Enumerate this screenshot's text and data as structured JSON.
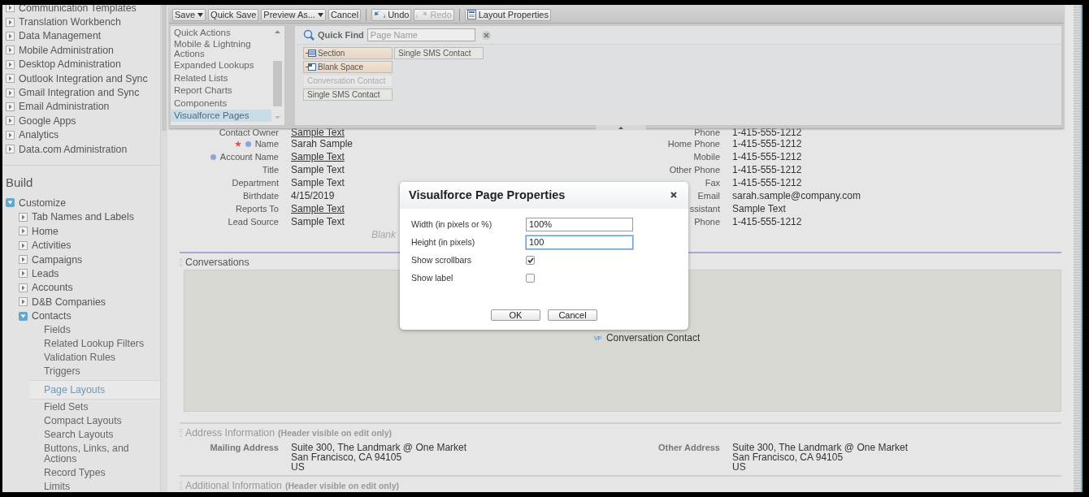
{
  "sidebar": {
    "items": [
      {
        "label": "Communication Templates",
        "kind": "node",
        "expanded": false
      },
      {
        "label": "Translation Workbench",
        "kind": "node",
        "expanded": false
      },
      {
        "label": "Data Management",
        "kind": "node",
        "expanded": false
      },
      {
        "label": "Mobile Administration",
        "kind": "node",
        "expanded": false
      },
      {
        "label": "Desktop Administration",
        "kind": "node",
        "expanded": false
      },
      {
        "label": "Outlook Integration and Sync",
        "kind": "node",
        "expanded": false
      },
      {
        "label": "Gmail Integration and Sync",
        "kind": "node",
        "expanded": false
      },
      {
        "label": "Email Administration",
        "kind": "node",
        "expanded": false
      },
      {
        "label": "Google Apps",
        "kind": "node",
        "expanded": false
      },
      {
        "label": "Analytics",
        "kind": "node",
        "expanded": false
      },
      {
        "label": "Data.com Administration",
        "kind": "node",
        "expanded": false
      }
    ],
    "build": {
      "title": "Build",
      "items": [
        {
          "label": "Customize",
          "kind": "node",
          "expanded": true,
          "children": [
            {
              "label": "Tab Names and Labels",
              "kind": "node",
              "expanded": false
            },
            {
              "label": "Home",
              "kind": "node",
              "expanded": false
            },
            {
              "label": "Activities",
              "kind": "node",
              "expanded": false
            },
            {
              "label": "Campaigns",
              "kind": "node",
              "expanded": false
            },
            {
              "label": "Leads",
              "kind": "node",
              "expanded": false
            },
            {
              "label": "Accounts",
              "kind": "node",
              "expanded": false
            },
            {
              "label": "D&B Companies",
              "kind": "node",
              "expanded": false
            },
            {
              "label": "Contacts",
              "kind": "node",
              "expanded": true,
              "children": [
                {
                  "label": "Fields",
                  "kind": "leaf",
                  "selected": false
                },
                {
                  "label": "Related Lookup Filters",
                  "kind": "leaf",
                  "selected": false
                },
                {
                  "label": "Validation Rules",
                  "kind": "leaf",
                  "selected": false
                },
                {
                  "label": "Triggers",
                  "kind": "leaf",
                  "selected": false
                },
                {
                  "label": "Page Layouts",
                  "kind": "leaf",
                  "selected": true
                },
                {
                  "label": "Field Sets",
                  "kind": "leaf",
                  "selected": false
                },
                {
                  "label": "Compact Layouts",
                  "kind": "leaf",
                  "selected": false
                },
                {
                  "label": "Search Layouts",
                  "kind": "leaf",
                  "selected": false
                },
                {
                  "label": "Buttons, Links, and Actions",
                  "kind": "leaf",
                  "selected": false
                },
                {
                  "label": "Record Types",
                  "kind": "leaf",
                  "selected": false
                },
                {
                  "label": "Limits",
                  "kind": "leaf",
                  "selected": false
                }
              ]
            }
          ]
        }
      ]
    }
  },
  "palette": {
    "toolbar": [
      {
        "label": "Save",
        "kind": "split",
        "disabled": false
      },
      {
        "label": "Quick Save",
        "kind": "button",
        "disabled": false
      },
      {
        "label": "Preview As...",
        "kind": "split",
        "disabled": false
      },
      {
        "label": "Cancel",
        "kind": "button",
        "disabled": false
      },
      {
        "kind": "separator"
      },
      {
        "label": "Undo",
        "kind": "undo",
        "disabled": false
      },
      {
        "label": "Redo",
        "kind": "redo",
        "disabled": true
      },
      {
        "kind": "separator"
      },
      {
        "label": "Layout Properties",
        "kind": "properties",
        "disabled": false
      }
    ],
    "categories": [
      {
        "label": "Quick Actions",
        "selected": false
      },
      {
        "label": "Mobile & Lightning Actions",
        "selected": false
      },
      {
        "label": "Expanded Lookups",
        "selected": false
      },
      {
        "label": "Related Lists",
        "selected": false
      },
      {
        "label": "Report Charts",
        "selected": false
      },
      {
        "label": "Components",
        "selected": false
      },
      {
        "label": "Visualforce Pages",
        "selected": true
      }
    ],
    "quick_find": {
      "label": "Quick Find",
      "placeholder": "Page Name"
    },
    "columns": [
      [
        {
          "label": "Section",
          "kind": "section",
          "used": false
        },
        {
          "label": "Blank Space",
          "kind": "blank",
          "used": false
        },
        {
          "label": "Conversation Contact",
          "kind": "page",
          "used": true
        },
        {
          "label": "Single SMS Contact",
          "kind": "page",
          "used": false
        }
      ],
      [
        {
          "label": "Single SMS Contact",
          "kind": "page",
          "used": false
        }
      ]
    ]
  },
  "record": {
    "left": [
      {
        "label": "Contact Owner",
        "value": "Sample Text",
        "link": true,
        "required": false,
        "dot": false
      },
      {
        "label": "Name",
        "value": "Sarah Sample",
        "link": false,
        "required": true,
        "dot": true
      },
      {
        "label": "Account Name",
        "value": "Sample Text",
        "link": true,
        "required": false,
        "dot": true
      },
      {
        "label": "Title",
        "value": "Sample Text",
        "link": false,
        "required": false,
        "dot": false
      },
      {
        "label": "Department",
        "value": "Sample Text",
        "link": false,
        "required": false,
        "dot": false
      },
      {
        "label": "Birthdate",
        "value": "4/15/2019",
        "link": false,
        "required": false,
        "dot": false
      },
      {
        "label": "Reports To",
        "value": "Sample Text",
        "link": true,
        "required": false,
        "dot": false
      },
      {
        "label": "Lead Source",
        "value": "Sample Text",
        "link": false,
        "required": false,
        "dot": false
      }
    ],
    "right": [
      {
        "label": "Phone",
        "value": "1-415-555-1212"
      },
      {
        "label": "Home Phone",
        "value": "1-415-555-1212"
      },
      {
        "label": "Mobile",
        "value": "1-415-555-1212"
      },
      {
        "label": "Other Phone",
        "value": "1-415-555-1212"
      },
      {
        "label": "Fax",
        "value": "1-415-555-1212"
      },
      {
        "label": "Email",
        "value": "sarah.sample@company.com"
      },
      {
        "label": "ssistant",
        "value": "Sample Text"
      },
      {
        "label": "Phone",
        "value": "1-415-555-1212"
      }
    ],
    "blank_hint": "Blank"
  },
  "conversations": {
    "title": "Conversations",
    "badge": "VF",
    "page": "Conversation Contact"
  },
  "address": {
    "title": "Address Information",
    "note": "(Header visible on edit only)",
    "left": {
      "label": "Mailing Address",
      "lines": [
        "Suite 300, The Landmark @ One Market",
        "San Francisco, CA 94105",
        "US"
      ]
    },
    "right": {
      "label": "Other Address",
      "lines": [
        "Suite 300, The Landmark @ One Market",
        "San Francisco, CA 94105",
        "US"
      ]
    }
  },
  "additional": {
    "title": "Additional Information",
    "note": "(Header visible on edit only)"
  },
  "dialog": {
    "title": "Visualforce Page Properties",
    "fields": [
      {
        "kind": "text",
        "label": "Width (in pixels or %)",
        "value": "100%",
        "focused": false
      },
      {
        "kind": "text",
        "label": "Height (in pixels)",
        "value": "100",
        "focused": true
      },
      {
        "kind": "checkbox",
        "label": "Show scrollbars",
        "checked": true
      },
      {
        "kind": "checkbox",
        "label": "Show label",
        "checked": false
      }
    ],
    "buttons": [
      "OK",
      "Cancel"
    ]
  }
}
